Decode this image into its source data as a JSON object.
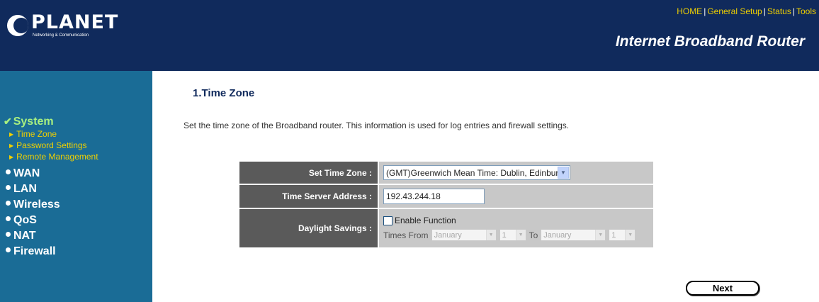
{
  "header": {
    "logo_text": "PLANET",
    "logo_subtitle": "Networking & Communication",
    "nav": [
      {
        "label": "HOME"
      },
      {
        "label": "General Setup"
      },
      {
        "label": "Status"
      },
      {
        "label": "Tools"
      }
    ],
    "separator": "|",
    "router_title": "Internet Broadband Router"
  },
  "sidebar": {
    "active": {
      "label": "System",
      "icon": "check-icon"
    },
    "subitems": [
      {
        "label": "Time Zone"
      },
      {
        "label": "Password Settings"
      },
      {
        "label": "Remote Management"
      }
    ],
    "items": [
      {
        "label": "WAN"
      },
      {
        "label": "LAN"
      },
      {
        "label": "Wireless"
      },
      {
        "label": "QoS"
      },
      {
        "label": "NAT"
      },
      {
        "label": "Firewall"
      }
    ]
  },
  "main": {
    "title": "1.Time Zone",
    "description": "Set the time zone of the Broadband router. This information is used for log entries and firewall settings.",
    "form": {
      "time_zone_label": "Set Time Zone :",
      "time_zone_value": "(GMT)Greenwich Mean Time: Dublin, Edinburgh, Lisbon, London",
      "server_label": "Time Server Address :",
      "server_value": "192.43.244.18",
      "daylight_label": "Daylight Savings :",
      "enable_label": "Enable Function",
      "enable_checked": false,
      "times_from_label": "Times From",
      "to_label": "To",
      "from_month": "January",
      "from_day": "1",
      "to_month": "January",
      "to_day": "1"
    },
    "next_label": "Next"
  },
  "colors": {
    "header_bg": "#102a5c",
    "sidebar_bg": "#1a6c96",
    "nav_link": "#f0d000",
    "active_menu": "#a8f080",
    "label_cell": "#5a5a5a",
    "value_cell": "#c8c8c8"
  }
}
